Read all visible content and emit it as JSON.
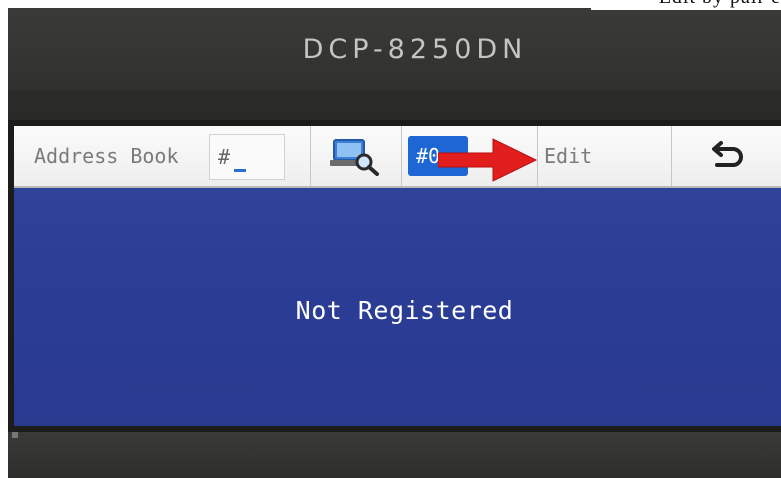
{
  "caption_fragment": "Edit by pair e",
  "device": {
    "model": "DCP-8250DN"
  },
  "lcd": {
    "toolbar": {
      "address_book_label": "Address Book",
      "hash_input_value": "#",
      "search_icon": "search-address-icon",
      "number_button_label": "#0",
      "edit_label": "Edit",
      "back_icon": "back-arrow-icon"
    },
    "message": "Not Registered"
  },
  "annotation": {
    "arrow_color": "#e11d1d"
  },
  "colors": {
    "lcd_blue": "#2c3f96",
    "toolbar_bg": "#f5f5f5",
    "selected_button": "#1d66d4"
  }
}
